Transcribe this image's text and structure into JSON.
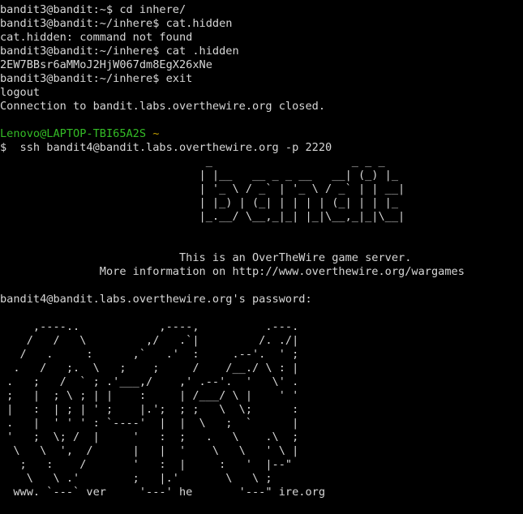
{
  "colors": {
    "background": "#000000",
    "text": "#d7d7d7",
    "user_host": "#34bc26",
    "path": "#c4a000"
  },
  "session": [
    "bandit3@bandit:~$ cd inhere/",
    "bandit3@bandit:~/inhere$ cat.hidden",
    "cat.hidden: command not found",
    "bandit3@bandit:~/inhere$ cat .hidden",
    "2EW7BBsr6aMMoJ2HjW067dm8EgX26xNe",
    "bandit3@bandit:~/inhere$ exit",
    "logout",
    "Connection to bandit.labs.overthewire.org closed."
  ],
  "local_prompt": {
    "user_host": "Lenovo@LAPTOP-TBI65A2S",
    "path": "~",
    "symbol": "$",
    "command": "  ssh bandit4@bandit.labs.overthewire.org -p 2220"
  },
  "bandit_banner": [
    "                               _                     _ _ _",
    "                              | |__   __ _ _ __   __| (_) |_",
    "                              | '_ \\ / _` | '_ \\ / _` | | __|",
    "                              | |_) | (_| | | | | (_| | | |_",
    "                              |_.__/ \\__,_|_| |_|\\__,_|_|\\__|"
  ],
  "server_info": [
    "                           This is an OverTheWire game server.",
    "               More information on http://www.overthewire.org/wargames"
  ],
  "password_prompt": "bandit4@bandit.labs.overthewire.org's password:",
  "otw_banner": [
    "     ,----..            ,----,          .---.",
    "    /   /   \\         ,/   .`|         /. ./|",
    "   /   .     :      ,`   .'  :     .--'.  ' ;",
    "  .   /   ;.  \\   ;    ;     /    /__./ \\ : |",
    " .   ;   /  ` ; .'___,/    ,' .--'.  '   \\' .",
    " ;   |  ; \\ ; | |    :     | /___/ \\ |    ' '",
    " |   :  | ; | ' ;    |.';  ; ;   \\  \\;      :",
    " .   |  ' ' ' : `----'  |  |  \\   ;  `      |",
    " '   ;  \\; /  |     '   :  ;   .   \\    .\\  ;",
    "  \\   \\  ',  /      |   |  '    \\   \\   ' \\ |",
    "   ;   :    /       '   :  |     :   '  |--\"",
    "    \\   \\ .'        ;   |.'       \\   \\ ;",
    "  www. `---` ver     '---' he       '---\" ire.org"
  ]
}
